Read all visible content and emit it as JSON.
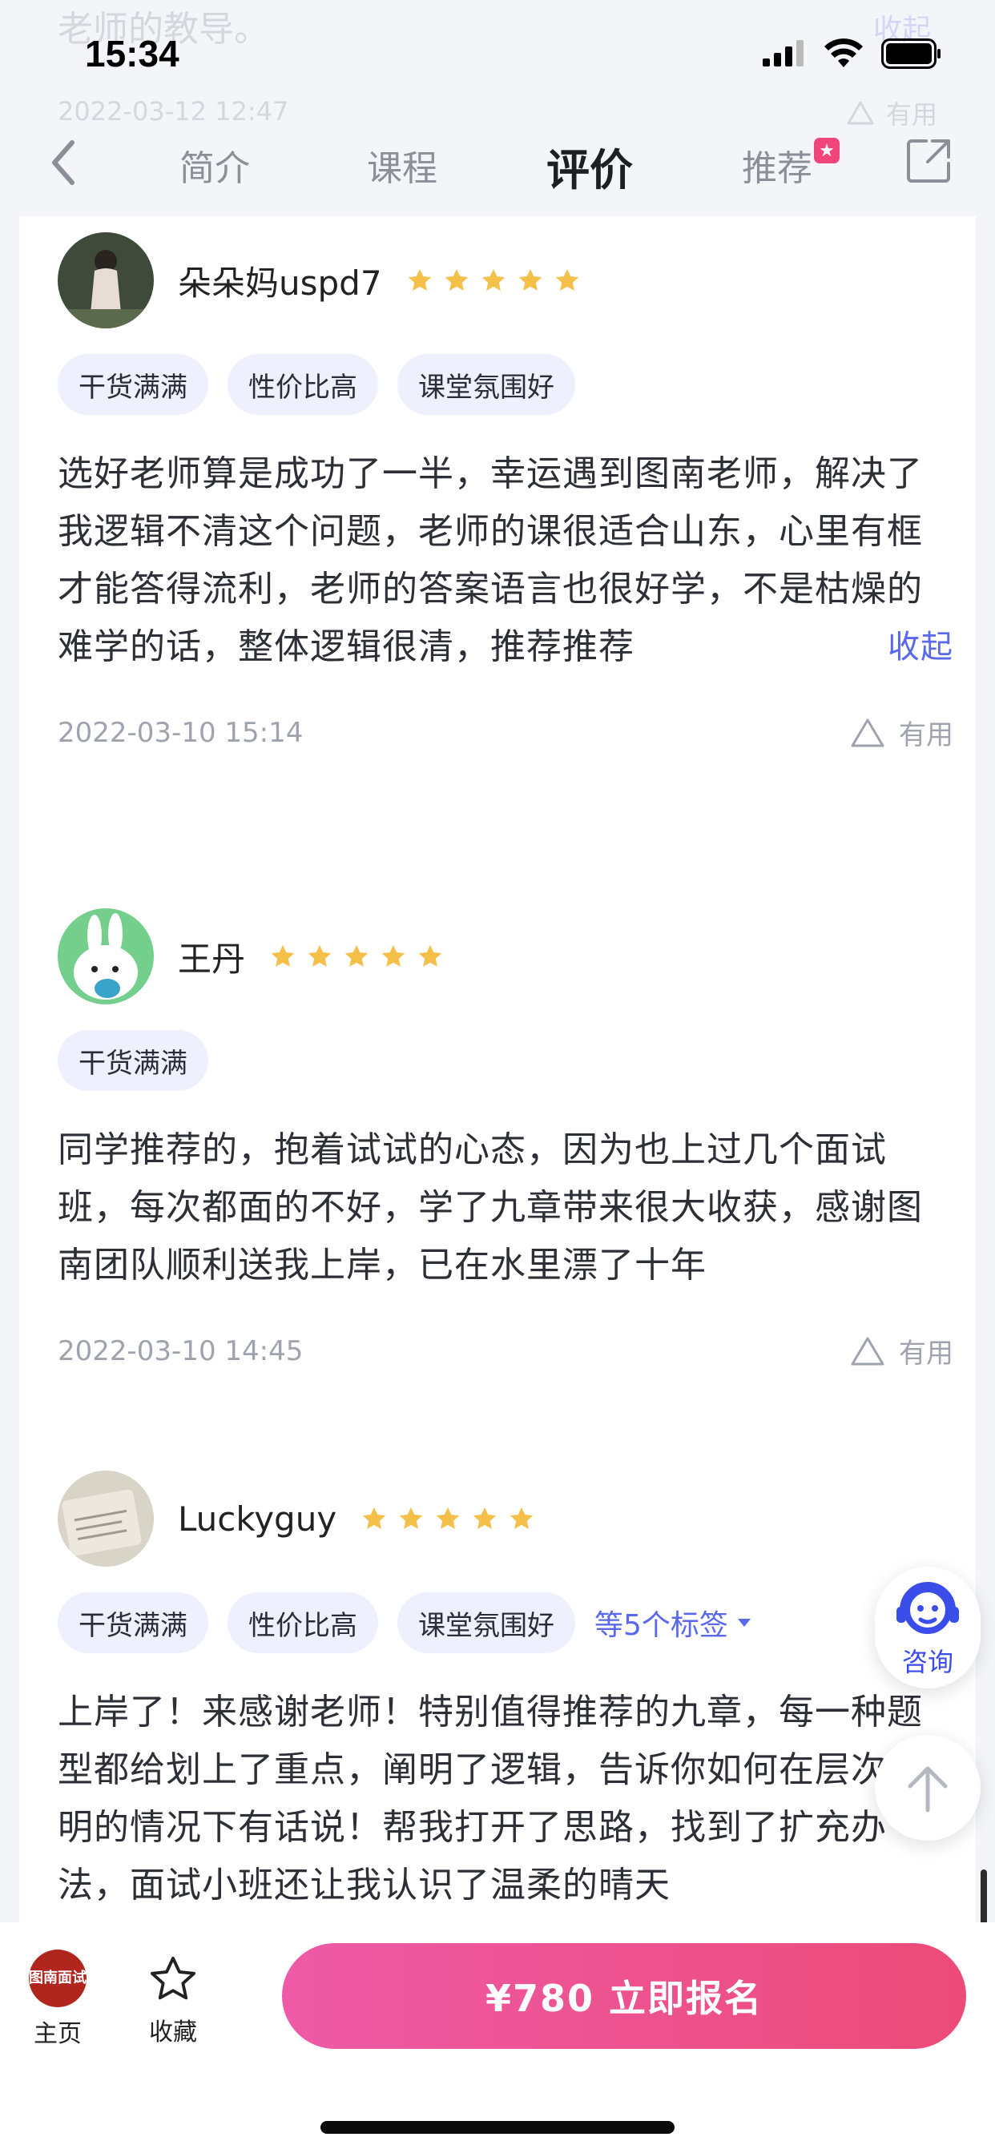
{
  "status_bar": {
    "time": "15:34"
  },
  "ghost": {
    "prev_text": "老师的教导。",
    "prev_collapse": "收起",
    "prev_date": "2022-03-12 12:47",
    "prev_helpful": "有用"
  },
  "nav": {
    "tabs": [
      {
        "label": "简介"
      },
      {
        "label": "课程"
      },
      {
        "label": "评价"
      },
      {
        "label": "推荐"
      }
    ],
    "active_tab": "评价"
  },
  "reviews": [
    {
      "user": "朵朵妈uspd7",
      "rating": 5,
      "tags": [
        "干货满满",
        "性价比高",
        "课堂氛围好"
      ],
      "text": "选好老师算是成功了一半，幸运遇到图南老师，解决了我逻辑不清这个问题，老师的课很适合山东，心里有框才能答得流利，老师的答案语言也很好学，不是枯燥的难学的话，整体逻辑很清，推荐推荐",
      "collapse": "收起",
      "date": "2022-03-10 15:14",
      "helpful": "有用"
    },
    {
      "user": "王丹",
      "rating": 5,
      "tags": [
        "干货满满"
      ],
      "text": "同学推荐的，抱着试试的心态，因为也上过几个面试班，每次都面的不好，学了九章带来很大收获，感谢图南团队顺利送我上岸，已在水里漂了十年",
      "date": "2022-03-10 14:45",
      "helpful": "有用"
    },
    {
      "user": "Luckyguy",
      "rating": 5,
      "tags": [
        "干货满满",
        "性价比高",
        "课堂氛围好"
      ],
      "more_tags": "等5个标签",
      "text": "上岸了！来感谢老师！特别值得推荐的九章，每一种题型都给划上了重点，阐明了逻辑，告诉你如何在层次分明的情况下有话说！帮我打开了思路，找到了扩充办法，面试小班还让我认识了温柔的晴天"
    }
  ],
  "floating": {
    "consult": "咨询"
  },
  "bottom_bar": {
    "home_logo": "图南面试",
    "home_label": "主页",
    "fav_label": "收藏",
    "cta": "¥780  立即报名"
  },
  "colors": {
    "accent": "#5a68ec",
    "cta_start": "#ee5aa6",
    "cta_end": "#ec4b78",
    "star": "#f5c04a"
  }
}
